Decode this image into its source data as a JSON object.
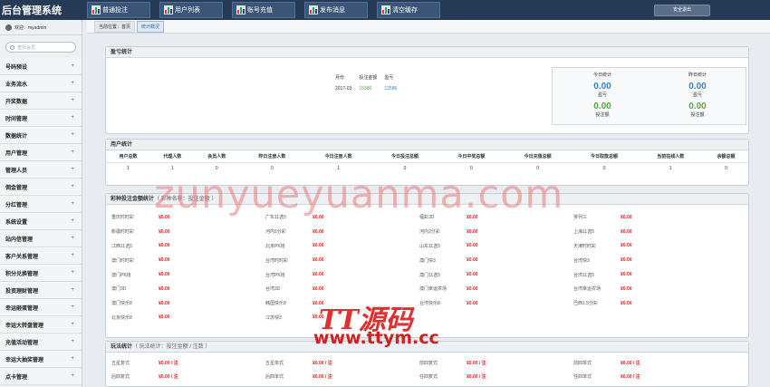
{
  "app": {
    "title": "后台管理系统"
  },
  "topnav": [
    {
      "label": "普通投注",
      "icon": "bar-chart-icon"
    },
    {
      "label": "用户列表",
      "icon": "bar-chart-icon"
    },
    {
      "label": "账号充值",
      "icon": "bar-chart-icon"
    },
    {
      "label": "发布消息",
      "icon": "bar-chart-icon"
    },
    {
      "label": "清空缓存",
      "icon": "bar-chart-icon"
    }
  ],
  "logout_label": "安全退出",
  "welcome": "欢迎：myadmin",
  "search_placeholder": "查找会员",
  "menu": [
    "号码预设",
    "业务流水",
    "开奖数据",
    "时间管理",
    "数据统计",
    "用户管理",
    "管理人员",
    "佣金管理",
    "分红管理",
    "系统设置",
    "站内信管理",
    "客户关系管理",
    "积分兑换管理",
    "投资理财管理",
    "幸运砸蛋管理",
    "幸运大转盘管理",
    "充值活动管理",
    "幸运大抽奖管理",
    "点卡管理"
  ],
  "breadcrumb": {
    "prefix": "当前位置：首页",
    "current": "统计概况"
  },
  "profit": {
    "title": "盈亏统计",
    "headers": [
      "月份",
      "投注金额",
      "盈亏"
    ],
    "row": [
      "2017-03",
      "15386",
      "12586"
    ],
    "today_label": "今日统计",
    "yesterday_label": "昨日统计",
    "today_profit": "0.00",
    "today_profit_label": "盈亏",
    "today_bet": "0.00",
    "today_bet_label": "投注额",
    "yesterday_profit": "0.00",
    "yesterday_profit_label": "盈亏",
    "yesterday_bet": "0.00",
    "yesterday_bet_label": "投注额"
  },
  "users": {
    "title": "用户统计",
    "headers": [
      "用户总数",
      "代理人数",
      "会员人数",
      "昨日注册人数",
      "今日注册人数",
      "今日投注总额",
      "今日中奖总额",
      "今日充值总额",
      "今日取款总额",
      "当前在线人数",
      "余额总额"
    ],
    "values": [
      "1",
      "1",
      "0",
      "0",
      "1",
      "0",
      "0",
      "0",
      "0",
      "1",
      "0"
    ]
  },
  "lottery": {
    "title": "彩种投注金额统计",
    "subtitle": "（ 彩种名称：投注金额 ）",
    "items": [
      [
        "重庆时时彩",
        "¥0.00"
      ],
      [
        "广东11选5",
        "¥0.00"
      ],
      [
        "福彩3D",
        "¥0.00"
      ],
      [
        "排列三",
        "¥0.00"
      ],
      [
        "新疆时时彩",
        "¥0.00"
      ],
      [
        "河内5分彩",
        "¥0.00"
      ],
      [
        "河内2分彩",
        "¥0.00"
      ],
      [
        "上海11选5",
        "¥0.00"
      ],
      [
        "江西11选5",
        "¥0.00"
      ],
      [
        "北京PK拾",
        "¥0.00"
      ],
      [
        "山东11选5",
        "¥0.00"
      ],
      [
        "天津时时彩",
        "¥0.00"
      ],
      [
        "澳门时时彩",
        "¥0.00"
      ],
      [
        "台湾时时彩",
        "¥0.00"
      ],
      [
        "澳门快3",
        "¥0.00"
      ],
      [
        "台湾快3",
        "¥0.00"
      ],
      [
        "澳门PK拾",
        "¥0.00"
      ],
      [
        "台湾PK拾",
        "¥0.00"
      ],
      [
        "澳门11选5",
        "¥0.00"
      ],
      [
        "台湾11选5",
        "¥0.00"
      ],
      [
        "澳门3D",
        "¥0.00"
      ],
      [
        "台湾3D",
        "¥0.00"
      ],
      [
        "澳门幸运农场",
        "¥0.00"
      ],
      [
        "台湾幸运农场",
        "¥0.00"
      ],
      [
        "澳门快乐8",
        "¥0.00"
      ],
      [
        "韩国快乐8",
        "¥0.00"
      ],
      [
        "台湾快乐8",
        "¥0.00"
      ],
      [
        "巴西1.5分彩",
        "¥0.00"
      ],
      [
        "北京快乐8",
        "¥0.00"
      ],
      [
        "江苏快3",
        "¥0.00"
      ]
    ]
  },
  "plays": {
    "title": "玩法统计",
    "subtitle": "（ 玩法统计：投注金额 / 注数 ）",
    "items": [
      [
        "五星复式",
        "¥0.00 / 注"
      ],
      [
        "五星单式",
        "¥0.00 / 注"
      ],
      [
        "前四复式",
        "¥0.00 / 注"
      ],
      [
        "前四单式",
        "¥0.00 / 注"
      ],
      [
        "后四复式",
        "¥0.00 / 注"
      ],
      [
        "后四单式",
        "¥0.00 / 注"
      ],
      [
        "任四复式",
        "¥0.00 / 注"
      ],
      [
        "任四单式",
        "¥0.00 / 注"
      ]
    ]
  },
  "watermark": {
    "url_text": "zunyueyuanma.com",
    "brand": "TT源码",
    "site": "www.ttym.cc"
  }
}
